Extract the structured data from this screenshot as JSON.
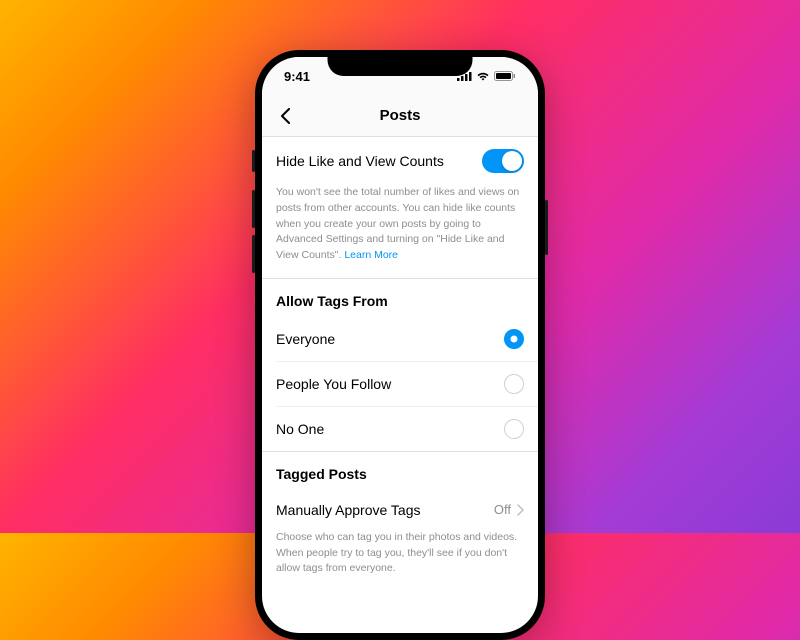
{
  "status_bar": {
    "time": "9:41"
  },
  "header": {
    "title": "Posts"
  },
  "hide_counts": {
    "label": "Hide Like and View Counts",
    "description": "You won't see the total number of likes and views on posts from other accounts. You can hide like counts when you create your own posts by going to Advanced Settings and turning on \"Hide Like and View Counts\".",
    "learn_more": "Learn More",
    "enabled": true
  },
  "allow_tags": {
    "title": "Allow Tags From",
    "options": [
      {
        "label": "Everyone",
        "selected": true
      },
      {
        "label": "People You Follow",
        "selected": false
      },
      {
        "label": "No One",
        "selected": false
      }
    ]
  },
  "tagged_posts": {
    "title": "Tagged Posts",
    "manually_approve_label": "Manually Approve Tags",
    "manually_approve_value": "Off",
    "description": "Choose who can tag you in their photos and videos. When people try to tag you, they'll see if you don't allow tags from everyone."
  }
}
